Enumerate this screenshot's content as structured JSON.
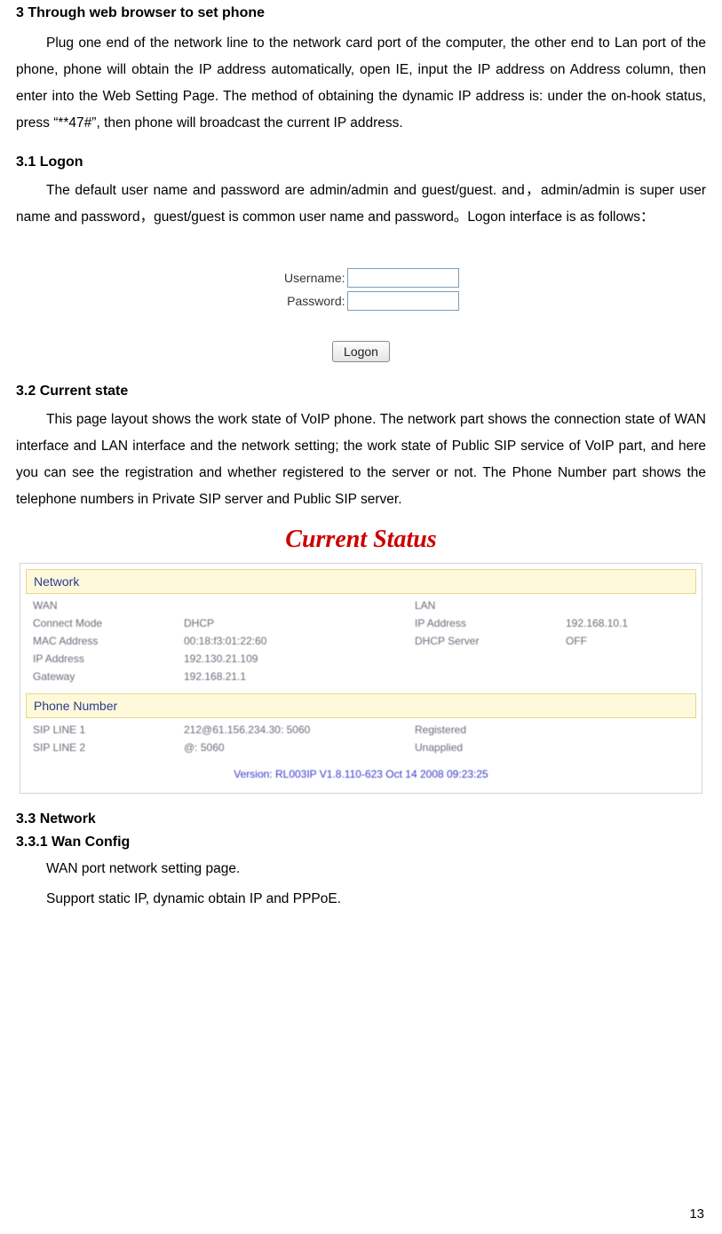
{
  "section3": {
    "title": "3 Through web browser to set phone",
    "p1": "Plug one end of the network line to the network card port of the computer, the other end to Lan port of the phone, phone will obtain the IP address automatically, open IE, input the IP address on Address column, then enter into the Web Setting Page. The method of obtaining the dynamic IP address is: under the on-hook status, press “**47#”, then phone will broadcast the current IP address."
  },
  "section31": {
    "title": "3.1 Logon",
    "p1": "The default user name and password are admin/admin and guest/guest. and，admin/admin is super user name and password，guest/guest is common user name and password。Logon interface is as follows：",
    "form": {
      "username_label": "Username:",
      "password_label": "Password:",
      "username_value": "",
      "password_value": "",
      "logon_button": "Logon"
    }
  },
  "section32": {
    "title": "3.2 Current state",
    "p1": "This page layout shows the work state of VoIP phone. The network part shows the connection state of WAN interface and LAN interface and the network setting; the work state of Public SIP service of VoIP part, and here you can see the registration and whether registered to the server or not. The Phone Number part shows the telephone numbers in Private SIP server and Public SIP server.",
    "status": {
      "heading": "Current Status",
      "network_band": "Network",
      "network": {
        "wan_label": "WAN",
        "lan_label": "LAN",
        "connect_mode_label": "Connect Mode",
        "connect_mode_value": "DHCP",
        "ip_address_label_r": "IP Address",
        "ip_address_value_r": "192.168.10.1",
        "mac_label": "MAC Address",
        "mac_value": "00:18:f3:01:22:60",
        "dhcp_server_label": "DHCP Server",
        "dhcp_server_value": "OFF",
        "ip_address_label_l": "IP Address",
        "ip_address_value_l": "192.130.21.109",
        "gateway_label": "Gateway",
        "gateway_value": "192.168.21.1"
      },
      "phone_band": "Phone Number",
      "phone": {
        "sip1_label": "SIP LINE 1",
        "sip1_value": "212@61.156.234.30: 5060",
        "sip1_status": "Registered",
        "sip2_label": "SIP LINE 2",
        "sip2_value": "@: 5060",
        "sip2_status": "Unapplied"
      },
      "version": "Version: RL003IP V1.8.110-623 Oct 14 2008 09:23:25"
    }
  },
  "section33": {
    "title": "3.3 Network",
    "sub331_title": "3.3.1 Wan Config",
    "p1": "WAN port network setting page.",
    "p2": "Support static IP, dynamic obtain IP and PPPoE."
  },
  "page_number": "13"
}
